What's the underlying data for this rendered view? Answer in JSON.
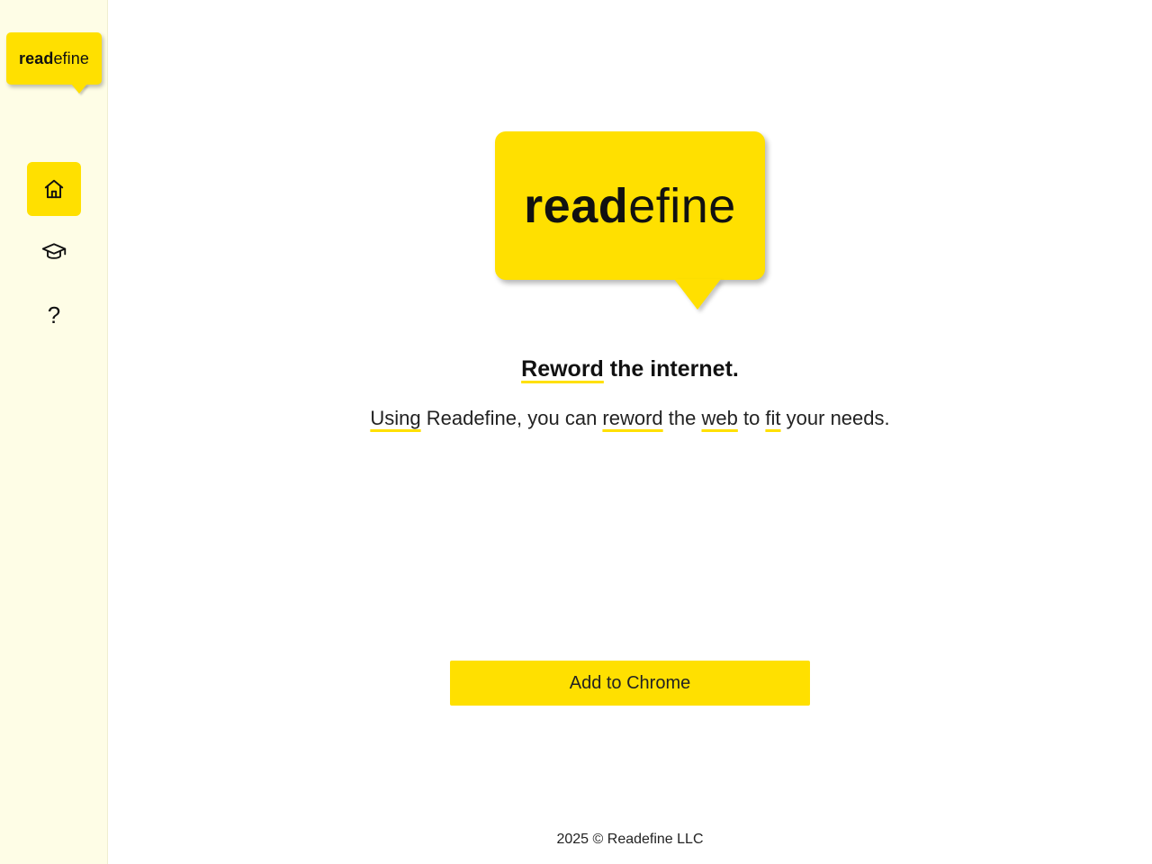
{
  "sidebar": {
    "logo": {
      "strong": "read",
      "light": "efine"
    },
    "nav": [
      {
        "name": "home",
        "icon": "home-icon",
        "active": true
      },
      {
        "name": "learn",
        "icon": "graduation-cap-icon",
        "active": false
      },
      {
        "name": "help",
        "icon": "question-mark-icon",
        "label": "?",
        "active": false
      }
    ]
  },
  "hero": {
    "logo": {
      "strong": "read",
      "light": "efine"
    },
    "headline": {
      "highlight": "Reword",
      "rest": " the internet."
    },
    "subline": {
      "w1": "Using",
      "t1": " Readefine, you can ",
      "w2": "reword",
      "t2": " the ",
      "w3": "web",
      "t3": " to ",
      "w4": "fit",
      "t4": " your needs."
    },
    "cta_label": "Add to Chrome"
  },
  "footer": {
    "text": "2025 © Readefine LLC"
  },
  "colors": {
    "accent": "#ffe000",
    "sidebar_bg": "#fefde6",
    "text": "#111111"
  }
}
